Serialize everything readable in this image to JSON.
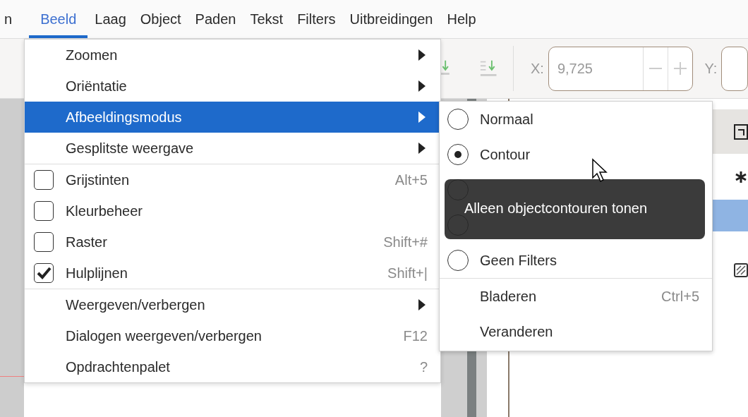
{
  "menubar": {
    "items": [
      {
        "label": "n",
        "selected": false
      },
      {
        "label": "Beeld",
        "selected": true
      },
      {
        "label": "Laag",
        "selected": false
      },
      {
        "label": "Object",
        "selected": false
      },
      {
        "label": "Paden",
        "selected": false
      },
      {
        "label": "Tekst",
        "selected": false
      },
      {
        "label": "Filters",
        "selected": false
      },
      {
        "label": "Uitbreidingen",
        "selected": false
      },
      {
        "label": "Help",
        "selected": false
      }
    ]
  },
  "toolbar": {
    "x_label": "X:",
    "x_value": "9,725",
    "y_label": "Y:"
  },
  "view_menu": {
    "items": [
      {
        "kind": "submenu",
        "label": "Zoomen",
        "selected": false
      },
      {
        "kind": "submenu",
        "label": "Oriëntatie",
        "selected": false
      },
      {
        "kind": "submenu",
        "label": "Afbeeldingsmodus",
        "selected": true
      },
      {
        "kind": "submenu",
        "label": "Gesplitste weergave",
        "selected": false
      },
      {
        "kind": "separator"
      },
      {
        "kind": "check",
        "label": "Grijstinten",
        "shortcut": "Alt+5",
        "checked": false,
        "selected": false
      },
      {
        "kind": "check",
        "label": "Kleurbeheer",
        "checked": false,
        "selected": false
      },
      {
        "kind": "check",
        "label": "Raster",
        "shortcut": "Shift+#",
        "checked": false,
        "selected": false
      },
      {
        "kind": "check",
        "label": "Hulplijnen",
        "shortcut": "Shift+|",
        "checked": true,
        "selected": false
      },
      {
        "kind": "separator"
      },
      {
        "kind": "submenu",
        "label": "Weergeven/verbergen",
        "selected": false
      },
      {
        "kind": "plain",
        "label": "Dialogen weergeven/verbergen",
        "shortcut": "F12",
        "selected": false
      },
      {
        "kind": "plain",
        "label": "Opdrachtenpalet",
        "shortcut": "?",
        "selected": false
      }
    ]
  },
  "display_mode_submenu": {
    "items": [
      {
        "kind": "radio",
        "label": "Normaal",
        "selected": false
      },
      {
        "kind": "radio",
        "label": "Contour",
        "selected": true
      },
      {
        "kind": "radio",
        "selected": false
      },
      {
        "kind": "radio",
        "selected": false
      },
      {
        "kind": "radio",
        "label": "Geen Filters",
        "selected": false
      },
      {
        "kind": "separator"
      },
      {
        "kind": "plain",
        "label": "Bladeren",
        "shortcut": "Ctrl+5"
      },
      {
        "kind": "plain",
        "label": "Veranderen"
      }
    ]
  },
  "tooltip": {
    "text": "Alleen objectcontouren tonen"
  }
}
